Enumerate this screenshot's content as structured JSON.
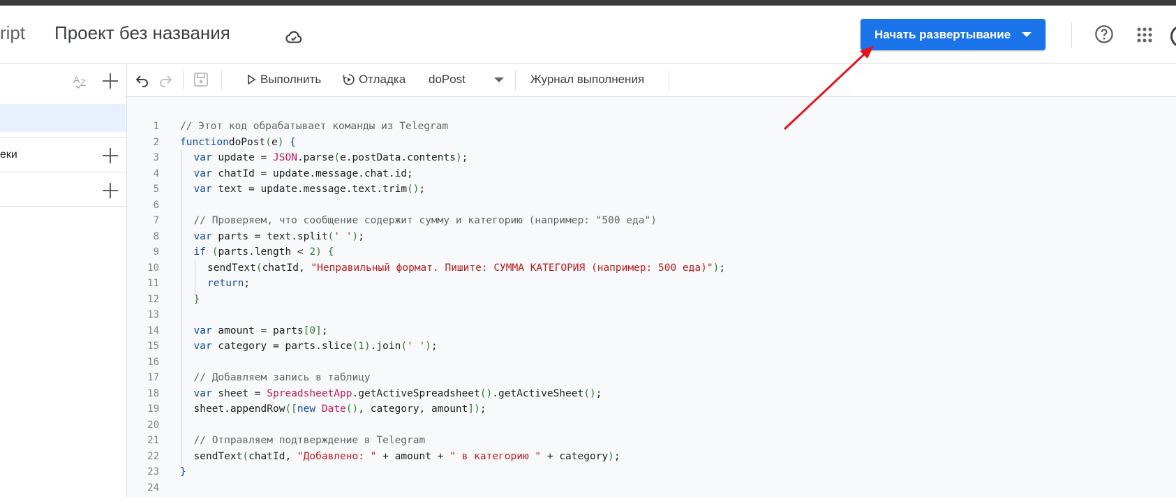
{
  "header": {
    "app_name": "ript",
    "project_title": "Проект без названия",
    "deploy_label": "Начать развертывание"
  },
  "sidebar": {
    "files_section_label": "",
    "libraries_label": "еки"
  },
  "toolbar": {
    "run_label": "Выполнить",
    "debug_label": "Отладка",
    "function_name": "doPost",
    "log_label": "Журнал выполнения"
  },
  "editor": {
    "line_numbers": [
      "1",
      "2",
      "3",
      "4",
      "5",
      "6",
      "7",
      "8",
      "9",
      "10",
      "11",
      "12",
      "13",
      "14",
      "15",
      "16",
      "17",
      "18",
      "19",
      "20",
      "21",
      "22",
      "23",
      "24"
    ],
    "lines": [
      {
        "indent": 0,
        "t": [
          [
            "cm",
            "// Этот код обрабатывает команды из Telegram"
          ]
        ]
      },
      {
        "indent": 0,
        "t": [
          [
            "kw",
            "function"
          ],
          [
            "",
            "doPost"
          ],
          [
            "pun",
            "("
          ],
          [
            "",
            "e"
          ],
          [
            "pun",
            ")"
          ],
          [
            "",
            " "
          ],
          [
            "kw",
            "{"
          ]
        ]
      },
      {
        "indent": 1,
        "t": [
          [
            "kw",
            "var"
          ],
          [
            "",
            " update = "
          ],
          [
            "cls",
            "JSON"
          ],
          [
            "",
            ".parse"
          ],
          [
            "pun",
            "("
          ],
          [
            "",
            "e.postData.contents"
          ],
          [
            "pun",
            ")"
          ],
          [
            "",
            ";"
          ]
        ]
      },
      {
        "indent": 1,
        "t": [
          [
            "kw",
            "var"
          ],
          [
            "",
            " chatId = update.message.chat.id;"
          ]
        ]
      },
      {
        "indent": 1,
        "t": [
          [
            "kw",
            "var"
          ],
          [
            "",
            " text = update.message.text.trim"
          ],
          [
            "pun",
            "()"
          ],
          [
            "",
            ";"
          ]
        ]
      },
      {
        "indent": 1,
        "t": []
      },
      {
        "indent": 1,
        "t": [
          [
            "cm",
            "// Проверяем, что сообщение содержит сумму и категорию (например: \"500 еда\")"
          ]
        ]
      },
      {
        "indent": 1,
        "t": [
          [
            "kw",
            "var"
          ],
          [
            "",
            " parts = text.split"
          ],
          [
            "pun",
            "("
          ],
          [
            "str",
            "' '"
          ],
          [
            "pun",
            ")"
          ],
          [
            "",
            ";"
          ]
        ]
      },
      {
        "indent": 1,
        "t": [
          [
            "kw",
            "if"
          ],
          [
            "",
            " "
          ],
          [
            "pun",
            "("
          ],
          [
            "",
            "parts.length < "
          ],
          [
            "num",
            "2"
          ],
          [
            "pun",
            ")"
          ],
          [
            "",
            " "
          ],
          [
            "pun",
            "{"
          ]
        ]
      },
      {
        "indent": 2,
        "t": [
          [
            "",
            "sendText"
          ],
          [
            "pun",
            "("
          ],
          [
            "",
            "chatId, "
          ],
          [
            "str",
            "\"Неправильный формат. Пишите: СУММА КАТЕГОРИЯ (например: 500 еда)\""
          ],
          [
            "pun",
            ")"
          ],
          [
            "",
            ";"
          ]
        ]
      },
      {
        "indent": 2,
        "t": [
          [
            "kw",
            "return"
          ],
          [
            "",
            ";"
          ]
        ]
      },
      {
        "indent": 1,
        "t": [
          [
            "pun",
            "}"
          ]
        ]
      },
      {
        "indent": 1,
        "t": []
      },
      {
        "indent": 1,
        "t": [
          [
            "kw",
            "var"
          ],
          [
            "",
            " amount = parts"
          ],
          [
            "pun",
            "["
          ],
          [
            "num",
            "0"
          ],
          [
            "pun",
            "]"
          ],
          [
            "",
            ";"
          ]
        ]
      },
      {
        "indent": 1,
        "t": [
          [
            "kw",
            "var"
          ],
          [
            "",
            " category = parts.slice"
          ],
          [
            "pun",
            "("
          ],
          [
            "num",
            "1"
          ],
          [
            "pun",
            ")"
          ],
          [
            "",
            ".join"
          ],
          [
            "pun",
            "("
          ],
          [
            "str",
            "' '"
          ],
          [
            "pun",
            ")"
          ],
          [
            "",
            ";"
          ]
        ]
      },
      {
        "indent": 1,
        "t": []
      },
      {
        "indent": 1,
        "t": [
          [
            "cm",
            "// Добавляем запись в таблицу"
          ]
        ]
      },
      {
        "indent": 1,
        "t": [
          [
            "kw",
            "var"
          ],
          [
            "",
            " sheet = "
          ],
          [
            "cls",
            "SpreadsheetApp"
          ],
          [
            "",
            ".getActiveSpreadsheet"
          ],
          [
            "pun",
            "()"
          ],
          [
            "",
            ".getActiveSheet"
          ],
          [
            "pun",
            "()"
          ],
          [
            "",
            ";"
          ]
        ]
      },
      {
        "indent": 1,
        "t": [
          [
            "",
            "sheet.appendRow"
          ],
          [
            "pun",
            "(["
          ],
          [
            "kw",
            "new"
          ],
          [
            "",
            " "
          ],
          [
            "cls",
            "Date"
          ],
          [
            "pun",
            "()"
          ],
          [
            "",
            ", category, amount"
          ],
          [
            "pun",
            "])"
          ],
          [
            "",
            ";"
          ]
        ]
      },
      {
        "indent": 1,
        "t": []
      },
      {
        "indent": 1,
        "t": [
          [
            "cm",
            "// Отправляем подтверждение в Telegram"
          ]
        ]
      },
      {
        "indent": 1,
        "t": [
          [
            "",
            "sendText"
          ],
          [
            "pun",
            "("
          ],
          [
            "",
            "chatId, "
          ],
          [
            "str",
            "\"Добавлено: \""
          ],
          [
            "",
            " + amount + "
          ],
          [
            "str",
            "\" в категорию \""
          ],
          [
            "",
            " + category"
          ],
          [
            "pun",
            ")"
          ],
          [
            "",
            ";"
          ]
        ]
      },
      {
        "indent": 0,
        "t": [
          [
            "kw",
            "}"
          ]
        ]
      },
      {
        "indent": 0,
        "t": []
      }
    ]
  }
}
